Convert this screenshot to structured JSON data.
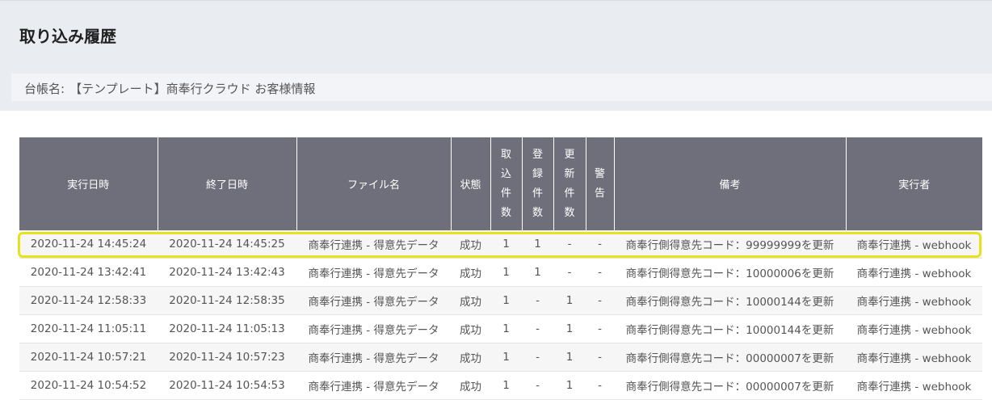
{
  "page": {
    "title": "取り込み履歴",
    "ledger_label": "台帳名:",
    "ledger_name": "【テンプレート】商奉行クラウド お客様情報"
  },
  "table": {
    "columns": {
      "started": "実行日時",
      "ended": "終了日時",
      "filename": "ファイル名",
      "status": "状態",
      "imported": "取込件数",
      "registered": "登録件数",
      "updated": "更新件数",
      "warnings": "警告",
      "notes": "備考",
      "executor": "実行者"
    },
    "rows": [
      {
        "started": "2020-11-24 14:45:24",
        "ended": "2020-11-24 14:45:25",
        "filename": "商奉行連携 - 得意先データ",
        "status": "成功",
        "imported": "1",
        "registered": "1",
        "updated": "-",
        "warnings": "-",
        "notes": "商奉行側得意先コード：99999999を更新",
        "executor": "商奉行連携 - webhook"
      },
      {
        "started": "2020-11-24 13:42:41",
        "ended": "2020-11-24 13:42:43",
        "filename": "商奉行連携 - 得意先データ",
        "status": "成功",
        "imported": "1",
        "registered": "1",
        "updated": "-",
        "warnings": "-",
        "notes": "商奉行側得意先コード：10000006を更新",
        "executor": "商奉行連携 - webhook"
      },
      {
        "started": "2020-11-24 12:58:33",
        "ended": "2020-11-24 12:58:35",
        "filename": "商奉行連携 - 得意先データ",
        "status": "成功",
        "imported": "1",
        "registered": "-",
        "updated": "1",
        "warnings": "-",
        "notes": "商奉行側得意先コード：10000144を更新",
        "executor": "商奉行連携 - webhook"
      },
      {
        "started": "2020-11-24 11:05:11",
        "ended": "2020-11-24 11:05:13",
        "filename": "商奉行連携 - 得意先データ",
        "status": "成功",
        "imported": "1",
        "registered": "-",
        "updated": "1",
        "warnings": "-",
        "notes": "商奉行側得意先コード：10000144を更新",
        "executor": "商奉行連携 - webhook"
      },
      {
        "started": "2020-11-24 10:57:21",
        "ended": "2020-11-24 10:57:23",
        "filename": "商奉行連携 - 得意先データ",
        "status": "成功",
        "imported": "1",
        "registered": "-",
        "updated": "1",
        "warnings": "-",
        "notes": "商奉行側得意先コード：00000007を更新",
        "executor": "商奉行連携 - webhook"
      },
      {
        "started": "2020-11-24 10:54:52",
        "ended": "2020-11-24 10:54:53",
        "filename": "商奉行連携 - 得意先データ",
        "status": "成功",
        "imported": "1",
        "registered": "-",
        "updated": "1",
        "warnings": "-",
        "notes": "商奉行側得意先コード：00000007を更新",
        "executor": "商奉行連携 - webhook"
      }
    ]
  },
  "colors": {
    "header_bg": "#6f6f7b",
    "page_bg": "#e9ecf1",
    "highlight": "#e7e21a"
  }
}
